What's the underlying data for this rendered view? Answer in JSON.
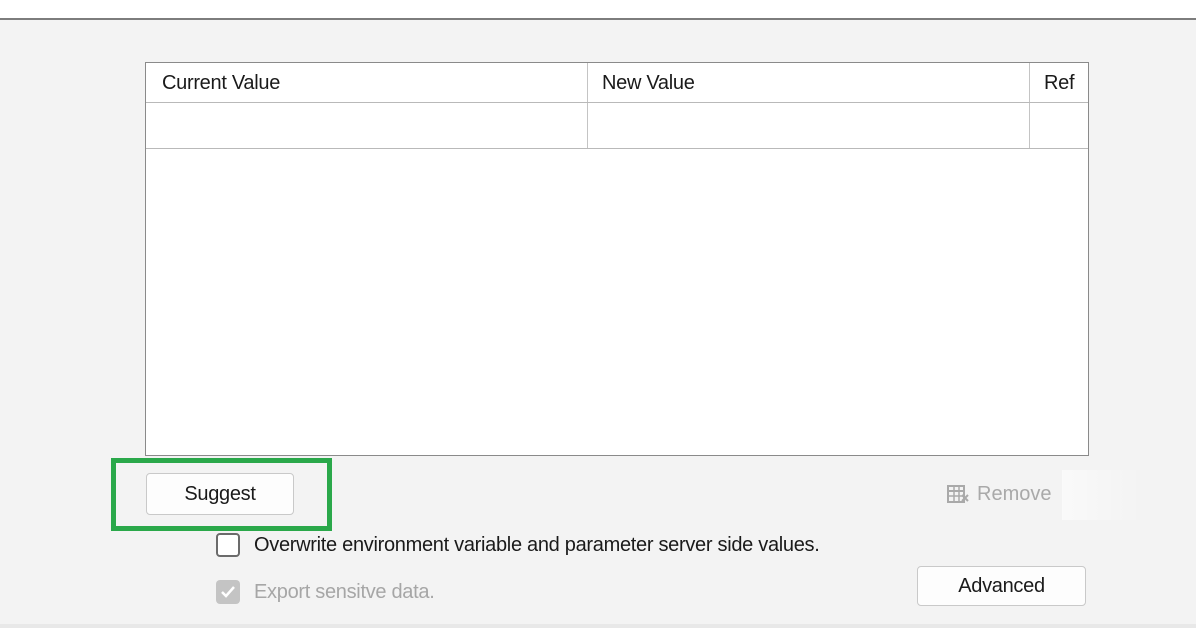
{
  "table": {
    "columns": [
      "Current Value",
      "New Value",
      "Ref"
    ],
    "rows": [
      {
        "current_value": "",
        "new_value": "",
        "ref": ""
      }
    ]
  },
  "buttons": {
    "suggest_label": "Suggest",
    "remove_label": "Remove",
    "advanced_label": "Advanced"
  },
  "options": {
    "overwrite_label": "Overwrite environment variable and parameter server side values.",
    "overwrite_checked": false,
    "export_label": "Export sensitve data.",
    "export_checked": true,
    "export_enabled": false
  },
  "icons": {
    "remove": "table-delete-icon",
    "export_check": "checkmark-icon"
  },
  "colors": {
    "highlight": "#2aa84a",
    "disabled_text": "#a6a6a6"
  }
}
